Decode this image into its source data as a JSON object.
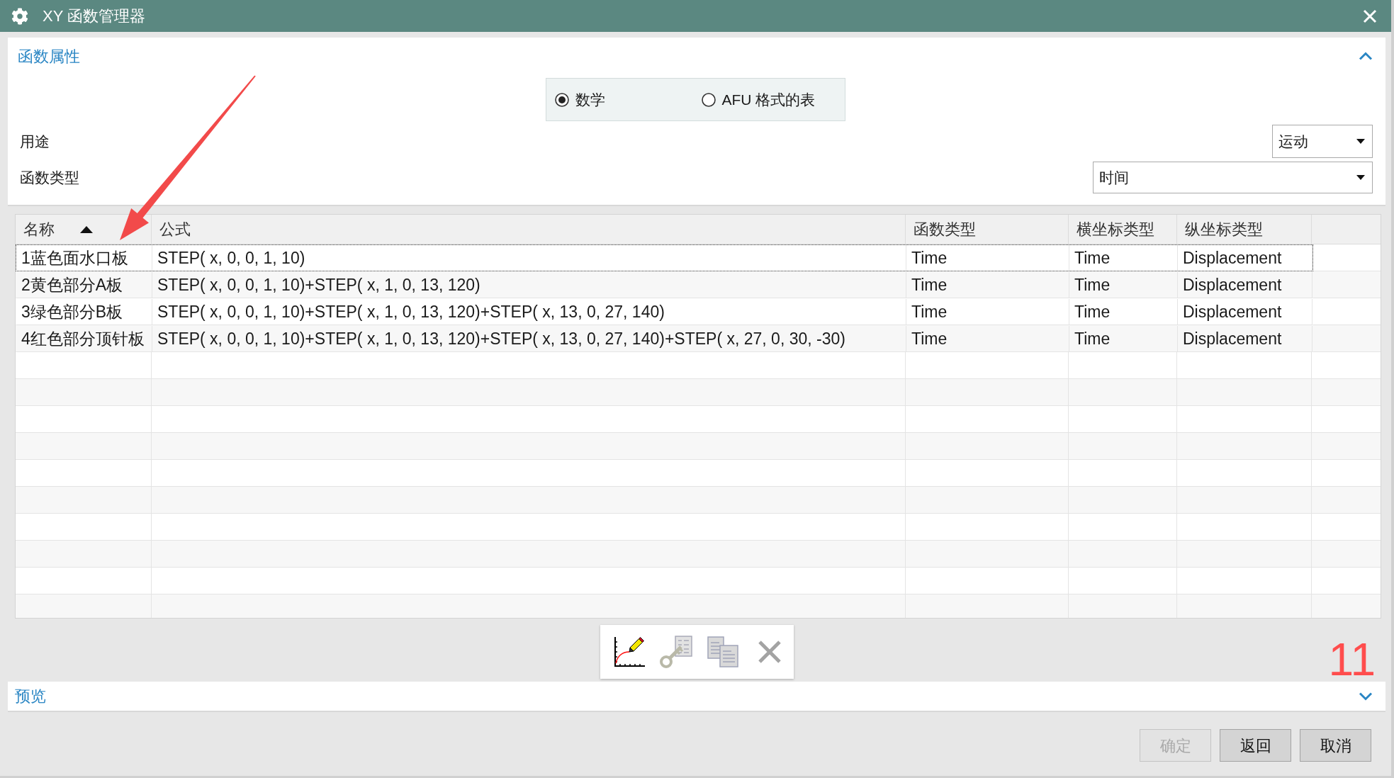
{
  "window": {
    "title": "XY 函数管理器"
  },
  "properties_panel": {
    "title": "函数属性",
    "expanded": true,
    "radio_options": [
      {
        "label": "数学",
        "selected": true
      },
      {
        "label": "AFU 格式的表",
        "selected": false
      }
    ],
    "fields": [
      {
        "label": "用途",
        "value": "运动"
      },
      {
        "label": "函数类型",
        "value": "时间"
      }
    ]
  },
  "table": {
    "columns": [
      {
        "label": "名称",
        "sorted_ascending": true
      },
      {
        "label": "公式",
        "sorted_ascending": false
      },
      {
        "label": "函数类型",
        "sorted_ascending": false
      },
      {
        "label": "横坐标类型",
        "sorted_ascending": false
      },
      {
        "label": "纵坐标类型",
        "sorted_ascending": false
      }
    ],
    "rows": [
      {
        "selected": true,
        "cells": [
          "1蓝色面水口板",
          "STEP( x, 0, 0, 1, 10)",
          "Time",
          "Time",
          "Displacement"
        ]
      },
      {
        "selected": false,
        "cells": [
          "2黄色部分A板",
          "STEP( x, 0, 0, 1, 10)+STEP( x, 1, 0, 13, 120)",
          "Time",
          "Time",
          "Displacement"
        ]
      },
      {
        "selected": false,
        "cells": [
          "3绿色部分B板",
          "STEP( x, 0, 0, 1, 10)+STEP( x, 1, 0, 13, 120)+STEP( x, 13, 0, 27, 140)",
          "Time",
          "Time",
          "Displacement"
        ]
      },
      {
        "selected": false,
        "cells": [
          "4红色部分顶针板",
          "STEP( x, 0, 0, 1, 10)+STEP( x, 1, 0, 13, 120)+STEP( x, 13, 0, 27, 140)+STEP( x, 27, 0, 30, -30)",
          "Time",
          "Time",
          "Displacement"
        ]
      }
    ]
  },
  "toolbar": [
    {
      "kind": "plot",
      "disabled": false
    },
    {
      "kind": "key",
      "disabled": true
    },
    {
      "kind": "copy",
      "disabled": true
    },
    {
      "kind": "delete",
      "disabled": true
    }
  ],
  "annotation": {
    "step_number": "11"
  },
  "preview_panel": {
    "title": "预览",
    "expanded": false
  },
  "buttons": [
    {
      "label": "确定",
      "disabled": true
    },
    {
      "label": "返回",
      "disabled": false
    },
    {
      "label": "取消",
      "disabled": false
    }
  ]
}
